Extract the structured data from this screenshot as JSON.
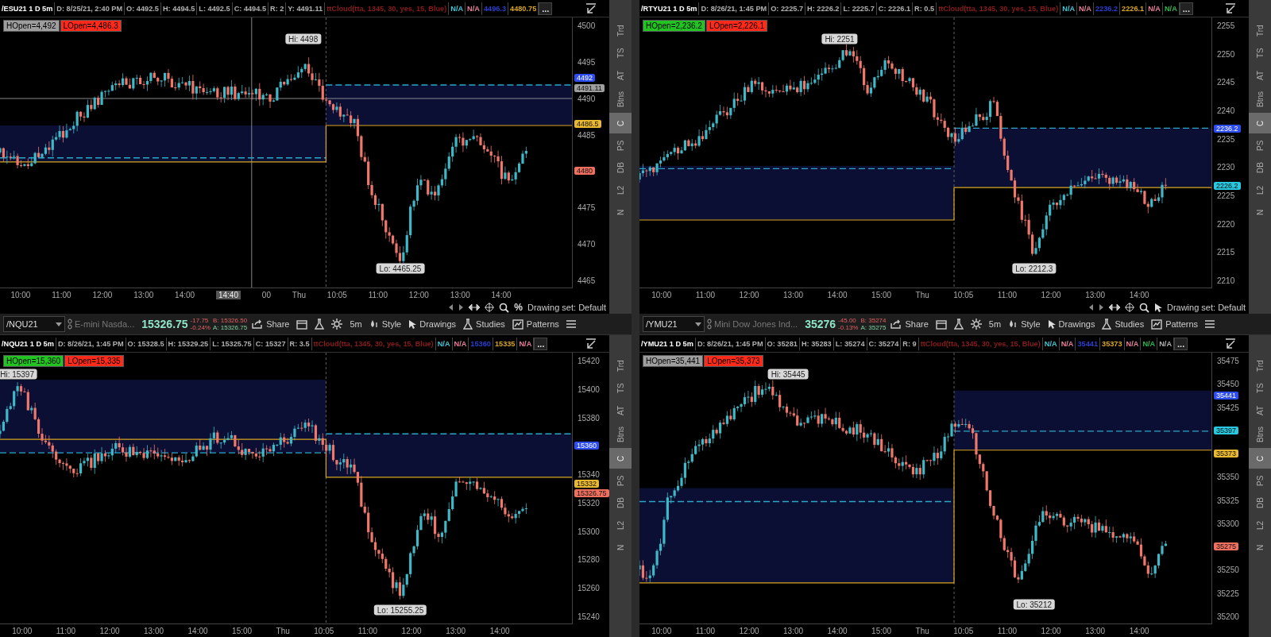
{
  "panels": [
    {
      "header": {
        "fields": [
          {
            "text": "/ESU21 1 D 5m",
            "color": "#ffffff"
          },
          {
            "text": "D: 8/25/21, 2:40 PM",
            "color": "#b0b0b0"
          },
          {
            "text": "O: 4492.5",
            "color": "#b0b0b0"
          },
          {
            "text": "H: 4494.5",
            "color": "#b0b0b0"
          },
          {
            "text": "L: 4492.5",
            "color": "#b0b0b0"
          },
          {
            "text": "C: 4494.5",
            "color": "#b0b0b0"
          },
          {
            "text": "R: 2",
            "color": "#b0b0b0"
          },
          {
            "text": "Y: 4491.11",
            "color": "#b0b0b0"
          },
          {
            "text": "ttCloud(tta, 1345, 30, yes, 15, Blue)",
            "color": "#8a1c1c"
          },
          {
            "text": "N/A",
            "color": "#3fc6d6"
          },
          {
            "text": "N/A",
            "color": "#e87f9a"
          },
          {
            "text": "4496.3",
            "color": "#2a3fd0"
          },
          {
            "text": "4480.75",
            "color": "#d9a520"
          },
          {
            "text": "...",
            "kind": "more"
          }
        ]
      },
      "badges": [
        {
          "text": "HOpen=4,492",
          "color": "#9e9e9e"
        },
        {
          "text": "LOpen=4,486.3",
          "color": "#ff2a1a"
        }
      ],
      "hi_label": "Hi: 4498",
      "lo_label": "Lo: 4465.25",
      "crosshair": {
        "time": "14:40"
      },
      "y_ticks": [
        "4500",
        "4495",
        "4490",
        "4485",
        "4475",
        "4470",
        "4465"
      ],
      "price_tags": [
        {
          "text": "4492",
          "color": "#2d4df0"
        },
        {
          "text": "4491.11",
          "color": "#9e9e9e"
        },
        {
          "text": "4486.5",
          "color": "#e8b830"
        },
        {
          "text": "4480",
          "color": "#f07060"
        }
      ],
      "x_labels": [
        "10:00",
        "11:00",
        "12:00",
        "13:00",
        "14:00",
        "00",
        "Thu",
        "10:05",
        "11:00",
        "12:00",
        "13:00",
        "14:00"
      ],
      "footer": {
        "label": "Drawing set: Default",
        "extra": "%"
      },
      "side_tabs": [
        {
          "label": "Trd",
          "selected": false
        },
        {
          "label": "TS",
          "selected": false
        },
        {
          "label": "AT",
          "selected": false
        },
        {
          "label": "Btns",
          "selected": false
        },
        {
          "label": "C",
          "selected": true
        },
        {
          "label": "PS",
          "selected": false
        },
        {
          "label": "DB",
          "selected": false
        },
        {
          "label": "L2",
          "selected": false
        },
        {
          "label": "N",
          "selected": false
        }
      ]
    },
    {
      "header": {
        "fields": [
          {
            "text": "/RTYU21 1 D 5m",
            "color": "#ffffff"
          },
          {
            "text": "D: 8/26/21, 1:45 PM",
            "color": "#b0b0b0"
          },
          {
            "text": "O: 2225.7",
            "color": "#b0b0b0"
          },
          {
            "text": "H: 2226.2",
            "color": "#b0b0b0"
          },
          {
            "text": "L: 2225.7",
            "color": "#b0b0b0"
          },
          {
            "text": "C: 2226.1",
            "color": "#b0b0b0"
          },
          {
            "text": "R: 0.5",
            "color": "#b0b0b0"
          },
          {
            "text": "ttCloud(tta, 1345, 30, yes, 15, Blue)",
            "color": "#8a1c1c"
          },
          {
            "text": "N/A",
            "color": "#3fc6d6"
          },
          {
            "text": "N/A",
            "color": "#e87f9a"
          },
          {
            "text": "2236.2",
            "color": "#2a3fd0"
          },
          {
            "text": "2226.1",
            "color": "#d9a520"
          },
          {
            "text": "N/A",
            "color": "#e87f9a"
          },
          {
            "text": "N/A",
            "color": "#2fb84a"
          },
          {
            "text": "...",
            "kind": "more"
          }
        ]
      },
      "badges": [
        {
          "text": "HOpen=2,236.2",
          "color": "#22c322"
        },
        {
          "text": "LOpen=2,226.1",
          "color": "#ff2a1a"
        }
      ],
      "hi_label": "Hi: 2251",
      "lo_label": "Lo: 2212.3",
      "y_ticks": [
        "2255",
        "2250",
        "2245",
        "2240",
        "2235",
        "2230",
        "2225",
        "2220",
        "2215",
        "2210"
      ],
      "price_tags": [
        {
          "text": "2236.2",
          "color": "#2d4df0"
        },
        {
          "text": "2226.2",
          "color": "#27c8e0"
        }
      ],
      "x_labels": [
        "10:00",
        "11:00",
        "12:00",
        "13:00",
        "14:00",
        "15:00",
        "Thu",
        "10:05",
        "11:00",
        "12:00",
        "13:00",
        "14:00"
      ],
      "footer": {
        "label": "Drawing set: Default"
      },
      "side_tabs": [
        {
          "label": "Trd",
          "selected": false
        },
        {
          "label": "TS",
          "selected": false
        },
        {
          "label": "AT",
          "selected": false
        },
        {
          "label": "Btns",
          "selected": false
        },
        {
          "label": "C",
          "selected": true
        },
        {
          "label": "PS",
          "selected": false
        },
        {
          "label": "DB",
          "selected": false
        },
        {
          "label": "L2",
          "selected": false
        },
        {
          "label": "N",
          "selected": false
        }
      ]
    },
    {
      "toolbar": {
        "symbol": "/NQU21",
        "description": "E-mini Nasda...",
        "last": "15326.75",
        "change": "-17.75",
        "change_pct": "-0.24%",
        "bid": "B: 15326.50",
        "ask": "A: 15326.75",
        "buttons": [
          {
            "kind": "share",
            "label": "Share"
          },
          {
            "kind": "calendar"
          },
          {
            "kind": "flask"
          },
          {
            "kind": "gear"
          },
          {
            "kind": "text",
            "label": "5m"
          },
          {
            "kind": "style",
            "label": "Style"
          },
          {
            "kind": "drawings",
            "label": "Drawings"
          },
          {
            "kind": "studies",
            "label": "Studies"
          },
          {
            "kind": "patterns",
            "label": "Patterns"
          },
          {
            "kind": "menu"
          }
        ]
      },
      "header": {
        "fields": [
          {
            "text": "/NQU21 1 D 5m",
            "color": "#ffffff"
          },
          {
            "text": "D: 8/26/21, 1:45 PM",
            "color": "#b0b0b0"
          },
          {
            "text": "O: 15328.5",
            "color": "#b0b0b0"
          },
          {
            "text": "H: 15329.25",
            "color": "#b0b0b0"
          },
          {
            "text": "L: 15325.75",
            "color": "#b0b0b0"
          },
          {
            "text": "C: 15327",
            "color": "#b0b0b0"
          },
          {
            "text": "R: 3.5",
            "color": "#b0b0b0"
          },
          {
            "text": "ttCloud(tta, 1345, 30, yes, 15, Blue)",
            "color": "#8a1c1c"
          },
          {
            "text": "N/A",
            "color": "#3fc6d6"
          },
          {
            "text": "N/A",
            "color": "#e87f9a"
          },
          {
            "text": "15360",
            "color": "#2a3fd0"
          },
          {
            "text": "15335",
            "color": "#d9a520"
          },
          {
            "text": "N/A",
            "color": "#e87f9a"
          },
          {
            "text": "...",
            "kind": "more"
          }
        ]
      },
      "badges": [
        {
          "text": "HOpen=15,360",
          "color": "#22c322"
        },
        {
          "text": "LOpen=15,335",
          "color": "#ff2a1a"
        }
      ],
      "hi_label": "Hi: 15397",
      "lo_label": "Lo: 15255.25",
      "y_ticks": [
        "15420",
        "15400",
        "15380",
        "15340",
        "15320",
        "15300",
        "15280",
        "15260",
        "15240"
      ],
      "price_tags": [
        {
          "text": "15360",
          "color": "#2d4df0"
        },
        {
          "text": "15332",
          "color": "#e8b830"
        },
        {
          "text": "15326.75",
          "color": "#f07060"
        }
      ],
      "x_labels": [
        "10:00",
        "11:00",
        "12:00",
        "13:00",
        "14:00",
        "15:00",
        "Thu",
        "10:05",
        "11:00",
        "12:00",
        "13:00",
        "14:00"
      ],
      "side_tabs": [
        {
          "label": "Trd",
          "selected": false
        },
        {
          "label": "TS",
          "selected": false
        },
        {
          "label": "AT",
          "selected": false
        },
        {
          "label": "Btns",
          "selected": false
        },
        {
          "label": "C",
          "selected": true
        },
        {
          "label": "PS",
          "selected": false
        },
        {
          "label": "DB",
          "selected": false
        },
        {
          "label": "L2",
          "selected": false
        },
        {
          "label": "N",
          "selected": false
        }
      ]
    },
    {
      "toolbar": {
        "symbol": "/YMU21",
        "description": "Mini Dow Jones Ind...",
        "last": "35276",
        "change": "-45.00",
        "change_pct": "-0.13%",
        "bid": "B: 35274",
        "ask": "A: 35275",
        "buttons": [
          {
            "kind": "share",
            "label": "Share"
          },
          {
            "kind": "calendar"
          },
          {
            "kind": "flask"
          },
          {
            "kind": "gear"
          },
          {
            "kind": "text",
            "label": "5m"
          },
          {
            "kind": "style",
            "label": "Style"
          },
          {
            "kind": "drawings",
            "label": "Drawings"
          },
          {
            "kind": "studies",
            "label": "Studies"
          },
          {
            "kind": "patterns",
            "label": "Patterns"
          },
          {
            "kind": "menu"
          }
        ]
      },
      "header": {
        "fields": [
          {
            "text": "/YMU21 1 D 5m",
            "color": "#ffffff"
          },
          {
            "text": "D: 8/26/21, 1:45 PM",
            "color": "#b0b0b0"
          },
          {
            "text": "O: 35281",
            "color": "#b0b0b0"
          },
          {
            "text": "H: 35283",
            "color": "#b0b0b0"
          },
          {
            "text": "L: 35274",
            "color": "#b0b0b0"
          },
          {
            "text": "C: 35274",
            "color": "#b0b0b0"
          },
          {
            "text": "R: 9",
            "color": "#b0b0b0"
          },
          {
            "text": "ttCloud(tta, 1345, 30, yes, 15, Blue)",
            "color": "#8a1c1c"
          },
          {
            "text": "N/A",
            "color": "#3fc6d6"
          },
          {
            "text": "N/A",
            "color": "#e87f9a"
          },
          {
            "text": "35441",
            "color": "#2a3fd0"
          },
          {
            "text": "35373",
            "color": "#d9a520"
          },
          {
            "text": "N/A",
            "color": "#e87f9a"
          },
          {
            "text": "N/A",
            "color": "#2fb84a"
          },
          {
            "text": "N/A",
            "color": "#b0b0b0"
          },
          {
            "text": "...",
            "kind": "more"
          }
        ]
      },
      "badges": [
        {
          "text": "HOpen=35,441",
          "color": "#9e9e9e"
        },
        {
          "text": "LOpen=35,373",
          "color": "#ff2a1a"
        }
      ],
      "hi_label": "Hi: 35445",
      "lo_label": "Lo: 35212",
      "y_ticks": [
        "35475",
        "35450",
        "35425",
        "35350",
        "35325",
        "35300",
        "35250",
        "35225",
        "35200"
      ],
      "price_tags": [
        {
          "text": "35441",
          "color": "#2d4df0"
        },
        {
          "text": "35397",
          "color": "#27c8e0"
        },
        {
          "text": "35373",
          "color": "#e8b830"
        },
        {
          "text": "35275",
          "color": "#f07060"
        }
      ],
      "x_labels": [
        "10:00",
        "11:00",
        "12:00",
        "13:00",
        "14:00",
        "15:00",
        "Thu",
        "10:05",
        "11:00",
        "12:00",
        "13:00",
        "14:00"
      ],
      "side_tabs": [
        {
          "label": "Trd",
          "selected": false
        },
        {
          "label": "TS",
          "selected": false
        },
        {
          "label": "AT",
          "selected": false
        },
        {
          "label": "Btns",
          "selected": false
        },
        {
          "label": "C",
          "selected": true
        },
        {
          "label": "PS",
          "selected": false
        },
        {
          "label": "DB",
          "selected": false
        },
        {
          "label": "L2",
          "selected": false
        },
        {
          "label": "N",
          "selected": false
        }
      ]
    }
  ]
}
